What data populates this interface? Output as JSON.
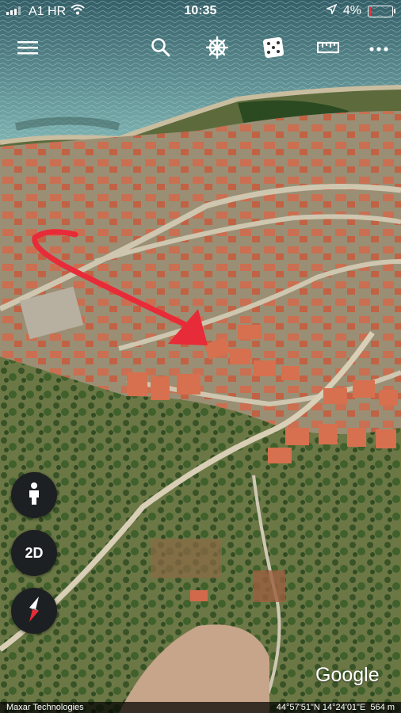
{
  "status_bar": {
    "carrier": "A1 HR",
    "time": "10:35",
    "battery_percent": "4%",
    "battery_level": 0.04,
    "battery_color": "#e8323b"
  },
  "toolbar": {
    "icons": [
      "menu-icon",
      "search-icon",
      "voyager-wheel-icon",
      "dice-icon",
      "ruler-icon",
      "more-icon"
    ]
  },
  "controls": {
    "street_view_icon": "person-icon",
    "view_toggle_label": "2D",
    "compass_icon": "compass-icon"
  },
  "map": {
    "logo": "Google",
    "attribution": "Maxar Technologies",
    "coordinates": "44°57'51\"N 14°24'01\"E",
    "altitude": "564 m",
    "annotation_arrow_color": "#e82b38"
  }
}
